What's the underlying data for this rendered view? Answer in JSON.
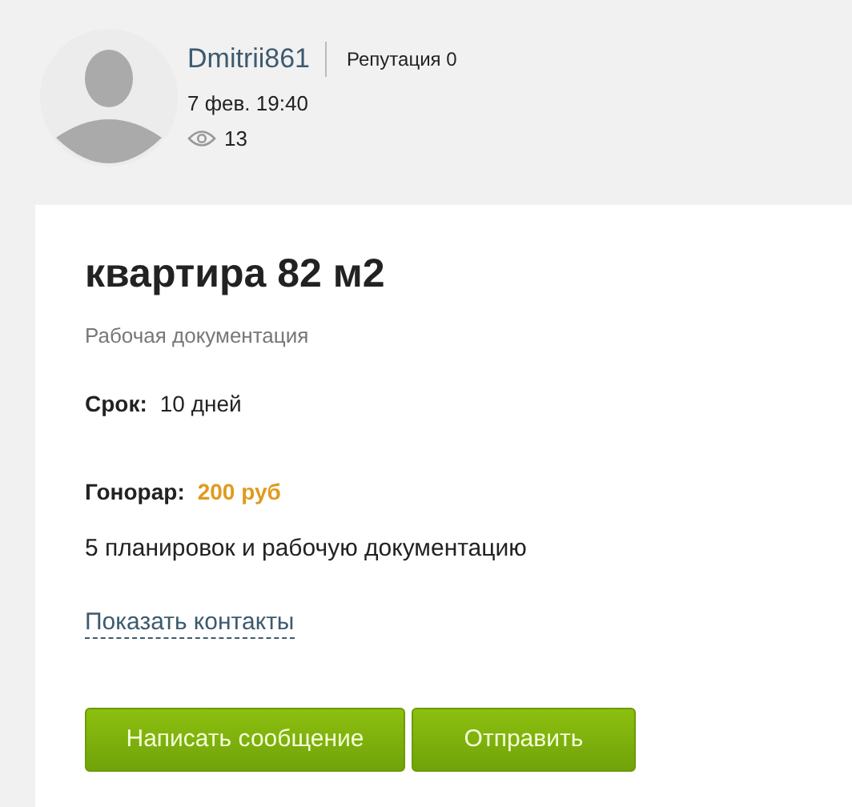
{
  "author": {
    "name": "Dmitrii861",
    "reputation": "Репутация 0",
    "date": "7 фев. 19:40",
    "views": "13"
  },
  "job": {
    "title": "квартира 82 м2",
    "category": "Рабочая документация",
    "fields": [
      {
        "label": "Срок:",
        "value": "10 дней",
        "kind": "plain"
      },
      {
        "label": "Гонорар:",
        "value": "200 руб",
        "kind": "price"
      }
    ],
    "description": "5 планировок и рабочую документацию",
    "contacts_link": "Показать контакты",
    "buttons": [
      "Написать сообщение",
      "Отправить"
    ]
  }
}
